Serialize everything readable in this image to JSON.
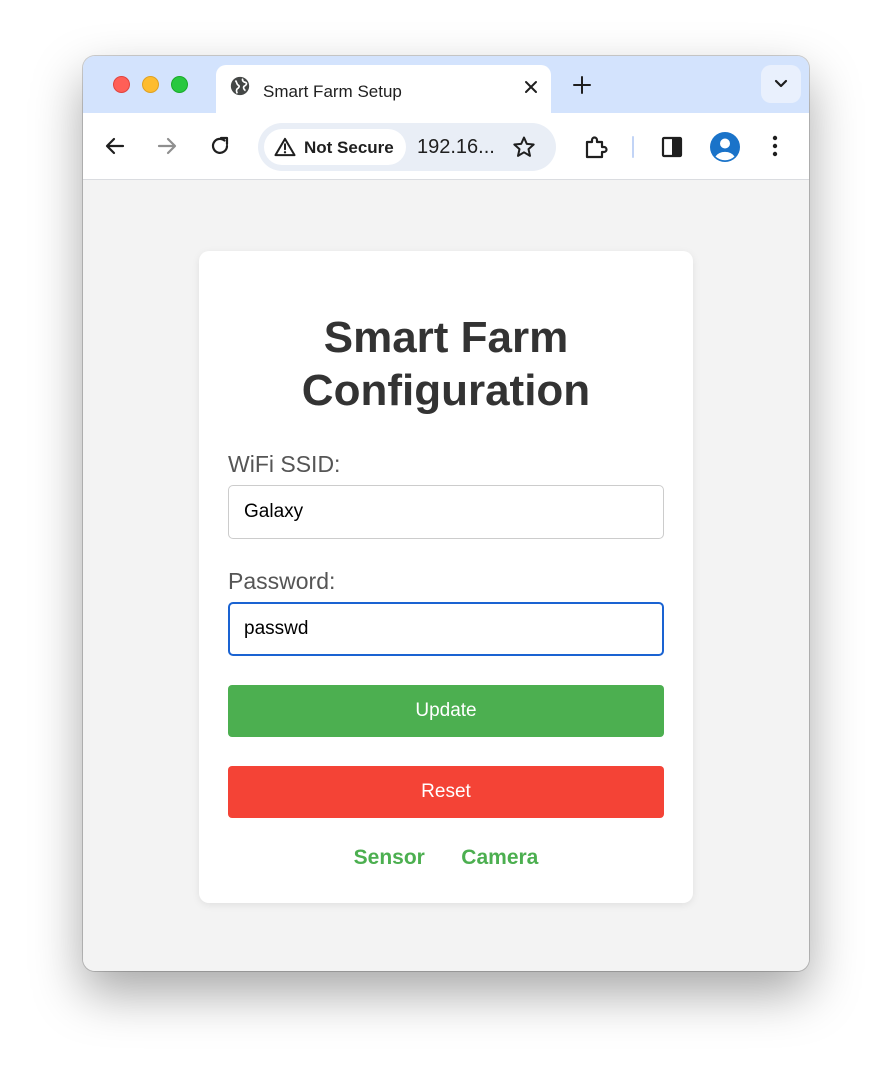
{
  "browser": {
    "tab_title": "Smart Farm Setup",
    "security_label": "Not Secure",
    "url": "192.16...",
    "icons": [
      "globe-icon",
      "close-icon",
      "plus-icon",
      "chevron-down-icon",
      "back-icon",
      "forward-icon",
      "reload-icon",
      "warning-icon",
      "star-icon",
      "extensions-icon",
      "sidepanel-icon",
      "profile-icon",
      "kebab-menu-icon"
    ]
  },
  "form": {
    "heading": "Smart Farm Configuration",
    "ssid_label": "WiFi SSID:",
    "ssid_value": "Galaxy",
    "password_label": "Password:",
    "password_value": "passwd",
    "update_label": "Update",
    "reset_label": "Reset",
    "links": {
      "sensor": "Sensor",
      "camera": "Camera"
    }
  },
  "colors": {
    "accent_green": "#4caf50",
    "reset_red": "#f44336",
    "focus_blue": "#1a63d2",
    "tabstrip": "#d3e3fd"
  }
}
